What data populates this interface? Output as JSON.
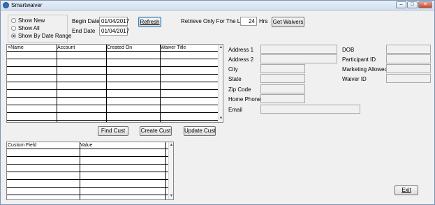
{
  "window": {
    "title": "Smartwaiver",
    "minimize": "–",
    "maximize": "□",
    "close": "✕"
  },
  "filters": {
    "options": [
      "Show New",
      "Show All",
      "Show By Date Range"
    ],
    "selected_index": 2,
    "begin_label": "Begin Date",
    "begin_value": "01/04/2017",
    "end_label": "End Date",
    "end_value": "01/04/2017",
    "refresh_label": "Refresh"
  },
  "retrieve": {
    "label": "Retrieve Only For The Last",
    "value": "24",
    "unit": "Hrs",
    "button": "Get Waivers"
  },
  "waivers_table": {
    "columns": [
      ">Name",
      "Account",
      "Created On",
      "Waiver Title"
    ]
  },
  "buttons": {
    "find": "Find Cust",
    "create": "Create Cust",
    "update": "Update Cust",
    "exit": "Exit"
  },
  "custom_table": {
    "columns": [
      "Custom Field",
      "Value",
      ""
    ]
  },
  "details": {
    "address1": "Address 1",
    "address2": "Address 2",
    "city": "City",
    "state": "State",
    "zip": "Zip Code",
    "phone": "Home Phone",
    "email": "Email",
    "dob": "DOB",
    "participant_id": "Participant ID",
    "marketing": "Marketing Allowed",
    "waiver_id": "Waiver ID"
  },
  "icons": {
    "app": "smartwaiver-app-icon",
    "scroll_up": "▲",
    "scroll_down": "▼"
  }
}
